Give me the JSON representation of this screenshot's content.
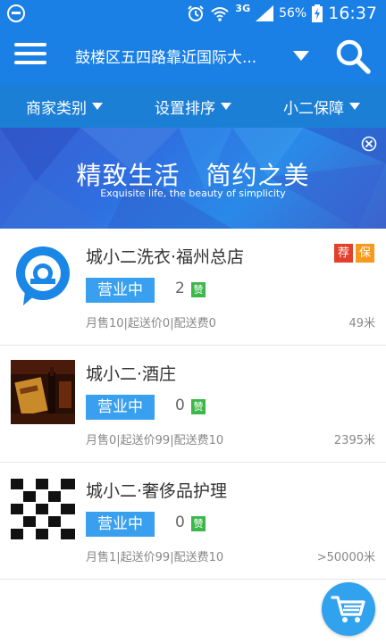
{
  "statusbar": {
    "network": "3G",
    "battery": "56%",
    "time": "16:37"
  },
  "header": {
    "location": "鼓楼区五四路靠近国际大...",
    "menu_icon": "hamburger-icon",
    "search_icon": "search-icon"
  },
  "filters": [
    {
      "label": "商家类别"
    },
    {
      "label": "设置排序"
    },
    {
      "label": "小二保障"
    }
  ],
  "banner": {
    "title": "精致生活　简约之美",
    "subtitle": "Exquisite life, the beauty of simplicity"
  },
  "stores": [
    {
      "name": "城小二洗衣·福州总店",
      "status": "营业中",
      "likes": "2",
      "zan": "赞",
      "meta": "月售10|起送价0|配送费0",
      "distance": "49米",
      "badge_recommend": "荐",
      "badge_guarantee": "保"
    },
    {
      "name": "城小二·酒庄",
      "status": "营业中",
      "likes": "0",
      "zan": "赞",
      "meta": "月售0|起送价99|配送费10",
      "distance": "2395米"
    },
    {
      "name": "城小二·奢侈品护理",
      "status": "营业中",
      "likes": "0",
      "zan": "赞",
      "meta": "月售1|起送价99|配送费10",
      "distance": ">50000米"
    }
  ],
  "colors": {
    "primary": "#1a80e6",
    "filter_bar": "#1c7fd6",
    "status_button": "#39a0f0",
    "zan": "#3cb84a",
    "badge_recommend": "#e2402c",
    "badge_guarantee": "#f59a1e"
  }
}
